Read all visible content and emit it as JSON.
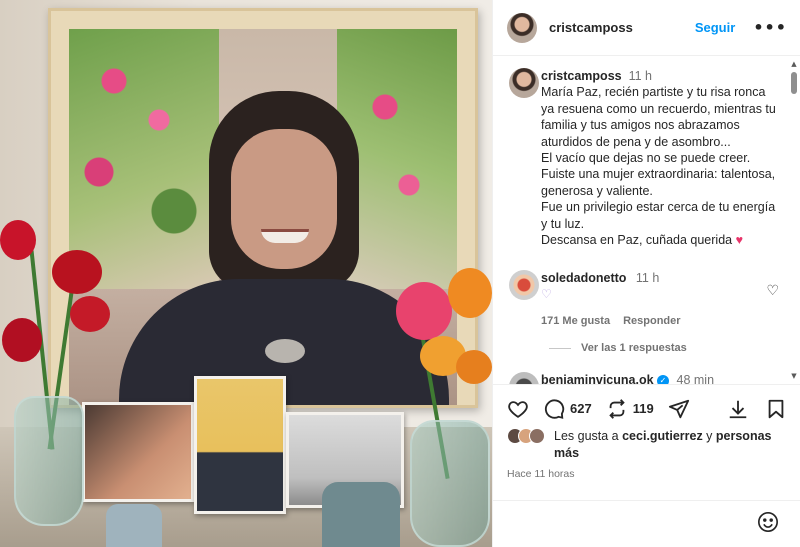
{
  "post": {
    "username": "cristcamposs",
    "follow_label": "Seguir",
    "more_label": "•••"
  },
  "caption": {
    "username": "cristcamposs",
    "time": "11 h",
    "text": "María Paz, recién partiste y tu risa ronca ya resuena como un recuerdo, mientras tu familia y tus amigos nos abrazamos aturdidos de pena y de asombro...\nEl vacío que dejas no se puede creer.\nFuiste una mujer extraordinaria: talentosa, generosa y valiente.\nFue un privilegio estar cerca de tu energía y tu luz.\nDescansa en Paz, cuñada querida",
    "emoji": "♥"
  },
  "comments": [
    {
      "username": "soledadonetto",
      "time": "11 h",
      "text": "♡",
      "likes": "171 Me gusta",
      "reply_label": "Responder",
      "view_replies": "Ver las 1 respuestas"
    },
    {
      "username": "benjaminvicuna.ok",
      "time": "48 min"
    }
  ],
  "actions": {
    "comment_count": "627",
    "repost_count": "119"
  },
  "likes": {
    "prefix": "Les gusta a ",
    "user": "ceci.gutierrez",
    "middle": " y ",
    "suffix": "personas más"
  },
  "timestamp": "Hace 11 horas",
  "colors": {
    "accent": "#0095f6",
    "text": "#262626",
    "muted": "#737373",
    "heart": "#e8356a"
  },
  "icons": [
    "heart-icon",
    "comment-icon",
    "repost-icon",
    "share-icon",
    "download-icon",
    "bookmark-icon",
    "smiley-icon",
    "verified-icon"
  ]
}
